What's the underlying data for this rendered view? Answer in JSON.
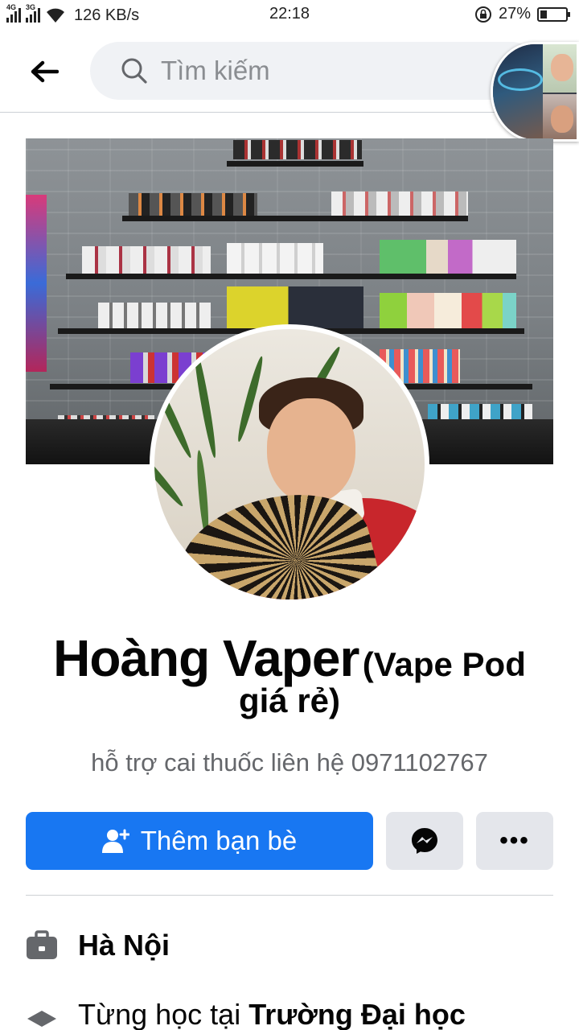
{
  "status_bar": {
    "network_1": "4G",
    "network_2": "3G",
    "speed": "126 KB/s",
    "time": "22:18",
    "battery_percent": "27%",
    "battery_level": 0.27
  },
  "header": {
    "back_icon": "arrow-left-icon",
    "search_placeholder": "Tìm kiếm"
  },
  "profile": {
    "name": "Hoàng Vaper",
    "alternate_name": "(Vape Pod giá rẻ)",
    "bio": "hỗ trợ cai thuốc liên hệ 0971102767"
  },
  "actions": {
    "add_friend_label": "Thêm bạn bè",
    "messenger_icon": "messenger-icon",
    "more_label": "•••"
  },
  "details": {
    "work": {
      "icon": "briefcase-icon",
      "text": "Hà Nội"
    },
    "education": {
      "icon": "graduation-cap-icon",
      "prefix": "Từng học tại ",
      "school": "Trường Đại học"
    }
  },
  "colors": {
    "primary": "#1877f2",
    "secondary_button": "#e4e6eb",
    "search_bg": "#f0f2f5",
    "muted_text": "#65676b"
  }
}
